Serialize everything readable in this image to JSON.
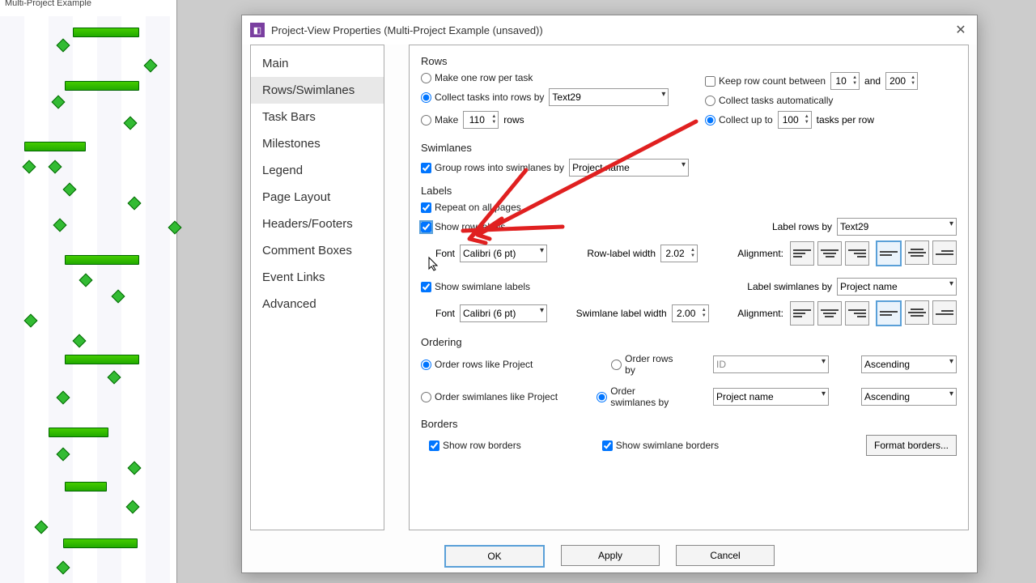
{
  "bg": {
    "tab_title": "Multi-Project Example"
  },
  "dialog": {
    "title": "Project-View Properties (Multi-Project Example (unsaved))"
  },
  "sidebar": {
    "items": [
      "Main",
      "Rows/Swimlanes",
      "Task Bars",
      "Milestones",
      "Legend",
      "Page Layout",
      "Headers/Footers",
      "Comment Boxes",
      "Event Links",
      "Advanced"
    ],
    "active_index": 1
  },
  "rows": {
    "title": "Rows",
    "opt_one_per_task": "Make one row per task",
    "opt_collect_by": "Collect tasks into rows by",
    "collect_by_value": "Text29",
    "opt_make": "Make",
    "make_value": "110",
    "make_suffix": "rows",
    "chk_keep_bounds": "Keep row count between",
    "keep_min": "10",
    "keep_and": "and",
    "keep_max": "200",
    "opt_collect_auto": "Collect tasks automatically",
    "opt_collect_upto": "Collect up to",
    "upto_value": "100",
    "upto_suffix": "tasks per row"
  },
  "swimlanes": {
    "title": "Swimlanes",
    "chk_group": "Group rows into swimlanes by",
    "group_value": "Project name"
  },
  "labels": {
    "title": "Labels",
    "chk_repeat": "Repeat on all pages",
    "chk_show_row": "Show row labels",
    "font_label": "Font",
    "row_font": "Calibri (6 pt)",
    "label_rows_by": "Label rows by",
    "label_rows_value": "Text29",
    "row_label_width": "Row-label width",
    "row_width_value": "2.02",
    "alignment": "Alignment:",
    "chk_show_swim": "Show swimlane labels",
    "sw_font": "Calibri (6 pt)",
    "label_sw_by": "Label swimlanes by",
    "label_sw_value": "Project name",
    "sw_label_width": "Swimlane label width",
    "sw_width_value": "2.00"
  },
  "ordering": {
    "title": "Ordering",
    "opt_rows_like": "Order rows like Project",
    "opt_rows_by": "Order rows by",
    "rows_by_value": "ID",
    "rows_dir": "Ascending",
    "opt_sw_like": "Order swimlanes like Project",
    "opt_sw_by": "Order swimlanes by",
    "sw_by_value": "Project name",
    "sw_dir": "Ascending"
  },
  "borders": {
    "title": "Borders",
    "chk_row": "Show row borders",
    "chk_sw": "Show swimlane borders",
    "btn_format": "Format borders..."
  },
  "buttons": {
    "ok": "OK",
    "apply": "Apply",
    "cancel": "Cancel"
  }
}
